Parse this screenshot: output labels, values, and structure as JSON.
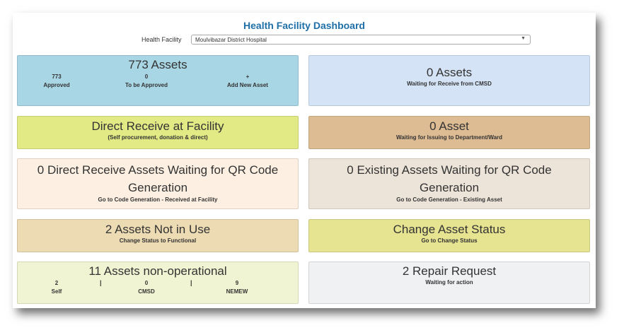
{
  "header": {
    "title": "Health Facility Dashboard",
    "facility_label": "Health Facility",
    "facility_selected": "Moulvibazar District Hospital"
  },
  "cards": {
    "assets": {
      "title": "773 Assets",
      "stats": [
        {
          "value": "773",
          "label": "Approved"
        },
        {
          "value": "0",
          "label": "To be Approved"
        },
        {
          "value": "+",
          "label": "Add New Asset"
        }
      ]
    },
    "cmsd": {
      "title": "0 Assets",
      "subtitle": "Waiting for Receive from CMSD"
    },
    "direct_receive": {
      "title": "Direct Receive at Facility",
      "subtitle": "(Self procurement, donation & direct)"
    },
    "issuing": {
      "title": "0 Asset",
      "subtitle": "Waiting for Issuing to Department/Ward"
    },
    "qr_direct": {
      "title": "0 Direct Receive Assets Waiting for QR Code Generation",
      "subtitle": "Go to Code Generation - Received at Facility"
    },
    "qr_existing": {
      "title": "0 Existing Assets Waiting for QR Code Generation",
      "subtitle": "Go to Code Generation - Existing Asset"
    },
    "not_in_use": {
      "title": "2 Assets Not in Use",
      "subtitle": "Change Status to Functional"
    },
    "change_status": {
      "title": "Change Asset Status",
      "subtitle": "Go to Change Status"
    },
    "non_operational": {
      "title": "11 Assets non-operational",
      "stats": [
        {
          "value": "2",
          "label": "Self"
        },
        {
          "value": "0",
          "label": "CMSD"
        },
        {
          "value": "9",
          "label": "NEMEW"
        }
      ],
      "separator": "|"
    },
    "repair": {
      "title": "2 Repair Request",
      "subtitle": "Waiting for action"
    }
  }
}
